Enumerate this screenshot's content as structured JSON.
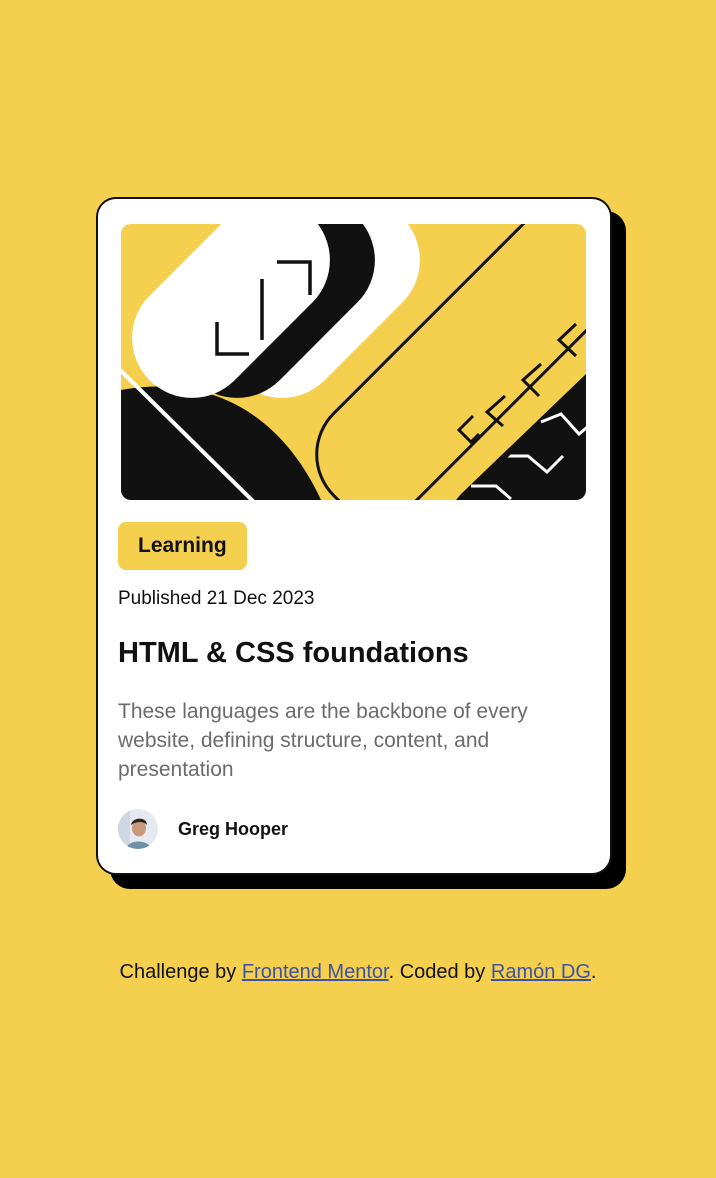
{
  "card": {
    "category": "Learning",
    "published": "Published 21 Dec 2023",
    "title": "HTML & CSS foundations",
    "description": "These languages are the backbone of every website, defining structure, content, and presentation",
    "author": {
      "name": "Greg Hooper"
    }
  },
  "footer": {
    "prefix": "Challenge by ",
    "link1": "Frontend Mentor",
    "middle": ". Coded by ",
    "link2": "Ramón DG",
    "suffix": "."
  },
  "colors": {
    "background": "#F4D04E",
    "card": "#FFFFFF",
    "ink": "#111111",
    "muted_text": "#6B6B6B",
    "link": "#3E52A3"
  }
}
